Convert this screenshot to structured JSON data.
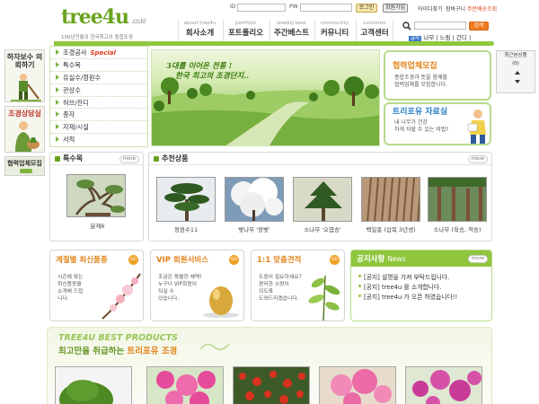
{
  "header": {
    "logo_text": "tree4u",
    "logo_domain": ".co.kr",
    "tagline": "100년전통의 한국최고의 종합조경",
    "id_label": "ID",
    "pw_label": "PW",
    "login_label": "로그인",
    "signup_label": "회원가입",
    "top_links": [
      "아이디찾기",
      "장바구니",
      "주문배송조회"
    ],
    "nav": [
      {
        "en": "about tree4u",
        "ko": "회사소개"
      },
      {
        "en": "portfolio",
        "ko": "포트폴리오"
      },
      {
        "en": "weekly best",
        "ko": "주간베스트"
      },
      {
        "en": "community",
        "ko": "커뮤니티"
      },
      {
        "en": "customer",
        "ko": "고객센터"
      }
    ],
    "search_button": "검색",
    "font_size_badge": "글자",
    "font_size_links": "나무 | 느림 | 간디 |"
  },
  "left_banners": {
    "warranty": "하자보수 의뢰하기",
    "consult": "조경상담실",
    "partner": "협력업체모집"
  },
  "left_menu": {
    "items": [
      "조경공사",
      "특수목",
      "유실수/정원수",
      "관상수",
      "허브/잔디",
      "종자",
      "자재/시설",
      "서적"
    ],
    "special": "Special"
  },
  "main_banner": {
    "line1": "3대를 이어온 전통 !",
    "line2": "한국 최고의 조경단지.."
  },
  "right_banners": {
    "partner_title": "협력업체모집",
    "partner_body": [
      "종합조경과 뜻을 함께할",
      "협력업체를 모집합니다."
    ],
    "data_title": "트리포유 자료실",
    "data_body": [
      "내 나무가 건강",
      "하게 자랄 수 있는 비법?"
    ]
  },
  "recent": {
    "title": "최근본상품",
    "count": "(0)"
  },
  "special_tree": {
    "title": "특수목",
    "more": "more",
    "caption": "분재6"
  },
  "recommended": {
    "title": "추천상품",
    "more": "more",
    "items": [
      "정원수11",
      "벚나무 '왕벚'",
      "소나무 '오엽송'",
      "백일홍 (삽목 3년생)",
      "소나무 (육송, 적송)"
    ]
  },
  "cards": [
    {
      "title": "계절별 최신품종",
      "go": "GO",
      "body": [
        "시즌에 맞는",
        "최신품종을",
        "소개해 드립",
        "니다."
      ]
    },
    {
      "title": "VIP 회원서비스",
      "go": "GO",
      "body": [
        "조금은 특별한 혜택!",
        "누구나 VIP회원이",
        "되실 수",
        "있습니다."
      ]
    },
    {
      "title": "1:1 맞춤견적",
      "go": "GO",
      "body": [
        "도움이 필요하세요?",
        "편리한 소량이",
        "되도록",
        "도와드리겠습니다."
      ]
    }
  ],
  "notice": {
    "title": "공지사항",
    "title_en": "News",
    "more": "more",
    "items": [
      "[공지] 설명을 가져 부탁드립니다.",
      "[공지] tree4u 를 소개합니다.",
      "[공지] tree4u 가 오픈 하였습니다!!"
    ]
  },
  "best": {
    "en": "TREE4U BEST PRODUCTS",
    "ko_prefix": "최고만을 취급하는 ",
    "ko_brand": "트리포유 조경"
  },
  "colors": {
    "brand_green": "#8fc63e",
    "accent_orange": "#e2841b",
    "link_blue": "#2a7fc6"
  }
}
